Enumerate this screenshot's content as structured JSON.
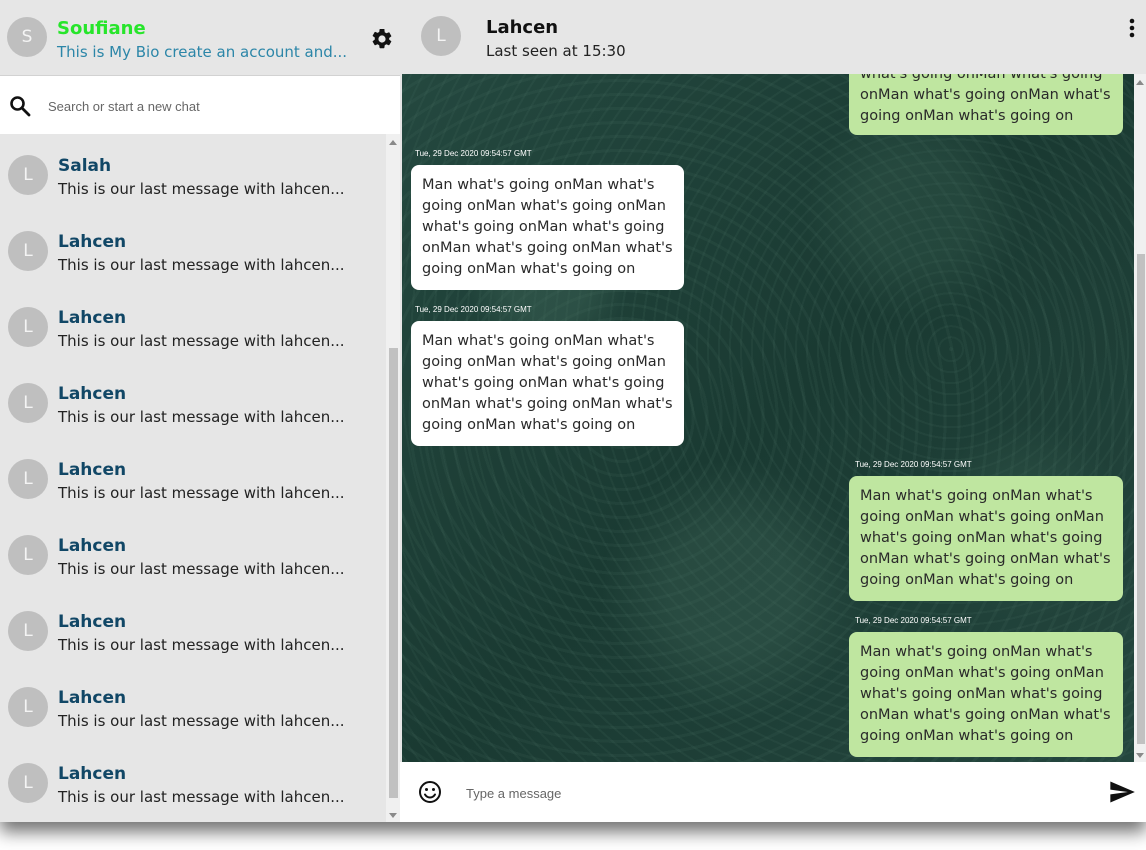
{
  "profile": {
    "avatar_letter": "S",
    "name": "Soufiane",
    "bio": "This is My Bio create an account and...",
    "settings_icon": "gear-icon"
  },
  "search": {
    "icon": "search-icon",
    "placeholder": "Search or start a new chat"
  },
  "chats": [
    {
      "avatar_letter": "L",
      "name": "Salah",
      "last_message": "This is our last message with lahcen..."
    },
    {
      "avatar_letter": "L",
      "name": "Lahcen",
      "last_message": "This is our last message with lahcen..."
    },
    {
      "avatar_letter": "L",
      "name": "Lahcen",
      "last_message": "This is our last message with lahcen..."
    },
    {
      "avatar_letter": "L",
      "name": "Lahcen",
      "last_message": "This is our last message with lahcen..."
    },
    {
      "avatar_letter": "L",
      "name": "Lahcen",
      "last_message": "This is our last message with lahcen..."
    },
    {
      "avatar_letter": "L",
      "name": "Lahcen",
      "last_message": "This is our last message with lahcen..."
    },
    {
      "avatar_letter": "L",
      "name": "Lahcen",
      "last_message": "This is our last message with lahcen..."
    },
    {
      "avatar_letter": "L",
      "name": "Lahcen",
      "last_message": "This is our last message with lahcen..."
    },
    {
      "avatar_letter": "L",
      "name": "Lahcen",
      "last_message": "This is our last message with lahcen..."
    }
  ],
  "conversation": {
    "contact": {
      "avatar_letter": "L",
      "name": "Lahcen",
      "last_seen": "Last seen at 15:30",
      "menu_icon": "more-vertical-icon"
    },
    "messages": [
      {
        "direction": "out",
        "timestamp": "",
        "lines": [
          "what's going onMan what's going",
          "onMan what's going onMan what's",
          "going onMan what's going on"
        ]
      },
      {
        "direction": "in",
        "timestamp": "Tue, 29 Dec 2020 09:54:57 GMT",
        "lines": [
          "Man what's going onMan what's",
          "going onMan what's going onMan",
          "what's going onMan what's going",
          "onMan what's going onMan what's",
          "going onMan what's going on"
        ]
      },
      {
        "direction": "in",
        "timestamp": "Tue, 29 Dec 2020 09:54:57 GMT",
        "lines": [
          "Man what's going onMan what's",
          "going onMan what's going onMan",
          "what's going onMan what's going",
          "onMan what's going onMan what's",
          "going onMan what's going on"
        ]
      },
      {
        "direction": "out",
        "timestamp": "Tue, 29 Dec 2020 09:54:57 GMT",
        "lines": [
          "Man what's going onMan what's",
          "going onMan what's going onMan",
          "what's going onMan what's going",
          "onMan what's going onMan what's",
          "going onMan what's going on"
        ]
      },
      {
        "direction": "out",
        "timestamp": "Tue, 29 Dec 2020 09:54:57 GMT",
        "lines": [
          "Man what's going onMan what's",
          "going onMan what's going onMan",
          "what's going onMan what's going",
          "onMan what's going onMan what's",
          "going onMan what's going on"
        ]
      }
    ]
  },
  "composer": {
    "emoji_icon": "emoji-icon",
    "placeholder": "Type a message",
    "send_icon": "send-icon"
  },
  "colors": {
    "profile_name": "#27e52b",
    "bio": "#2c86a8",
    "chat_name": "#114766",
    "incoming_bubble": "#ffffff",
    "outgoing_bubble": "#bfe6a0",
    "panel_bg": "#e6e6e6"
  }
}
